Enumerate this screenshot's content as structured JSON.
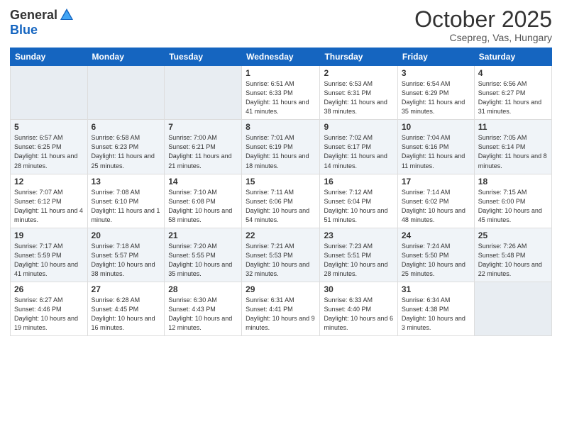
{
  "header": {
    "logo_general": "General",
    "logo_blue": "Blue",
    "month": "October 2025",
    "location": "Csepreg, Vas, Hungary"
  },
  "weekdays": [
    "Sunday",
    "Monday",
    "Tuesday",
    "Wednesday",
    "Thursday",
    "Friday",
    "Saturday"
  ],
  "weeks": [
    [
      {
        "day": "",
        "sunrise": "",
        "sunset": "",
        "daylight": ""
      },
      {
        "day": "",
        "sunrise": "",
        "sunset": "",
        "daylight": ""
      },
      {
        "day": "",
        "sunrise": "",
        "sunset": "",
        "daylight": ""
      },
      {
        "day": "1",
        "sunrise": "Sunrise: 6:51 AM",
        "sunset": "Sunset: 6:33 PM",
        "daylight": "Daylight: 11 hours and 41 minutes."
      },
      {
        "day": "2",
        "sunrise": "Sunrise: 6:53 AM",
        "sunset": "Sunset: 6:31 PM",
        "daylight": "Daylight: 11 hours and 38 minutes."
      },
      {
        "day": "3",
        "sunrise": "Sunrise: 6:54 AM",
        "sunset": "Sunset: 6:29 PM",
        "daylight": "Daylight: 11 hours and 35 minutes."
      },
      {
        "day": "4",
        "sunrise": "Sunrise: 6:56 AM",
        "sunset": "Sunset: 6:27 PM",
        "daylight": "Daylight: 11 hours and 31 minutes."
      }
    ],
    [
      {
        "day": "5",
        "sunrise": "Sunrise: 6:57 AM",
        "sunset": "Sunset: 6:25 PM",
        "daylight": "Daylight: 11 hours and 28 minutes."
      },
      {
        "day": "6",
        "sunrise": "Sunrise: 6:58 AM",
        "sunset": "Sunset: 6:23 PM",
        "daylight": "Daylight: 11 hours and 25 minutes."
      },
      {
        "day": "7",
        "sunrise": "Sunrise: 7:00 AM",
        "sunset": "Sunset: 6:21 PM",
        "daylight": "Daylight: 11 hours and 21 minutes."
      },
      {
        "day": "8",
        "sunrise": "Sunrise: 7:01 AM",
        "sunset": "Sunset: 6:19 PM",
        "daylight": "Daylight: 11 hours and 18 minutes."
      },
      {
        "day": "9",
        "sunrise": "Sunrise: 7:02 AM",
        "sunset": "Sunset: 6:17 PM",
        "daylight": "Daylight: 11 hours and 14 minutes."
      },
      {
        "day": "10",
        "sunrise": "Sunrise: 7:04 AM",
        "sunset": "Sunset: 6:16 PM",
        "daylight": "Daylight: 11 hours and 11 minutes."
      },
      {
        "day": "11",
        "sunrise": "Sunrise: 7:05 AM",
        "sunset": "Sunset: 6:14 PM",
        "daylight": "Daylight: 11 hours and 8 minutes."
      }
    ],
    [
      {
        "day": "12",
        "sunrise": "Sunrise: 7:07 AM",
        "sunset": "Sunset: 6:12 PM",
        "daylight": "Daylight: 11 hours and 4 minutes."
      },
      {
        "day": "13",
        "sunrise": "Sunrise: 7:08 AM",
        "sunset": "Sunset: 6:10 PM",
        "daylight": "Daylight: 11 hours and 1 minute."
      },
      {
        "day": "14",
        "sunrise": "Sunrise: 7:10 AM",
        "sunset": "Sunset: 6:08 PM",
        "daylight": "Daylight: 10 hours and 58 minutes."
      },
      {
        "day": "15",
        "sunrise": "Sunrise: 7:11 AM",
        "sunset": "Sunset: 6:06 PM",
        "daylight": "Daylight: 10 hours and 54 minutes."
      },
      {
        "day": "16",
        "sunrise": "Sunrise: 7:12 AM",
        "sunset": "Sunset: 6:04 PM",
        "daylight": "Daylight: 10 hours and 51 minutes."
      },
      {
        "day": "17",
        "sunrise": "Sunrise: 7:14 AM",
        "sunset": "Sunset: 6:02 PM",
        "daylight": "Daylight: 10 hours and 48 minutes."
      },
      {
        "day": "18",
        "sunrise": "Sunrise: 7:15 AM",
        "sunset": "Sunset: 6:00 PM",
        "daylight": "Daylight: 10 hours and 45 minutes."
      }
    ],
    [
      {
        "day": "19",
        "sunrise": "Sunrise: 7:17 AM",
        "sunset": "Sunset: 5:59 PM",
        "daylight": "Daylight: 10 hours and 41 minutes."
      },
      {
        "day": "20",
        "sunrise": "Sunrise: 7:18 AM",
        "sunset": "Sunset: 5:57 PM",
        "daylight": "Daylight: 10 hours and 38 minutes."
      },
      {
        "day": "21",
        "sunrise": "Sunrise: 7:20 AM",
        "sunset": "Sunset: 5:55 PM",
        "daylight": "Daylight: 10 hours and 35 minutes."
      },
      {
        "day": "22",
        "sunrise": "Sunrise: 7:21 AM",
        "sunset": "Sunset: 5:53 PM",
        "daylight": "Daylight: 10 hours and 32 minutes."
      },
      {
        "day": "23",
        "sunrise": "Sunrise: 7:23 AM",
        "sunset": "Sunset: 5:51 PM",
        "daylight": "Daylight: 10 hours and 28 minutes."
      },
      {
        "day": "24",
        "sunrise": "Sunrise: 7:24 AM",
        "sunset": "Sunset: 5:50 PM",
        "daylight": "Daylight: 10 hours and 25 minutes."
      },
      {
        "day": "25",
        "sunrise": "Sunrise: 7:26 AM",
        "sunset": "Sunset: 5:48 PM",
        "daylight": "Daylight: 10 hours and 22 minutes."
      }
    ],
    [
      {
        "day": "26",
        "sunrise": "Sunrise: 6:27 AM",
        "sunset": "Sunset: 4:46 PM",
        "daylight": "Daylight: 10 hours and 19 minutes."
      },
      {
        "day": "27",
        "sunrise": "Sunrise: 6:28 AM",
        "sunset": "Sunset: 4:45 PM",
        "daylight": "Daylight: 10 hours and 16 minutes."
      },
      {
        "day": "28",
        "sunrise": "Sunrise: 6:30 AM",
        "sunset": "Sunset: 4:43 PM",
        "daylight": "Daylight: 10 hours and 12 minutes."
      },
      {
        "day": "29",
        "sunrise": "Sunrise: 6:31 AM",
        "sunset": "Sunset: 4:41 PM",
        "daylight": "Daylight: 10 hours and 9 minutes."
      },
      {
        "day": "30",
        "sunrise": "Sunrise: 6:33 AM",
        "sunset": "Sunset: 4:40 PM",
        "daylight": "Daylight: 10 hours and 6 minutes."
      },
      {
        "day": "31",
        "sunrise": "Sunrise: 6:34 AM",
        "sunset": "Sunset: 4:38 PM",
        "daylight": "Daylight: 10 hours and 3 minutes."
      },
      {
        "day": "",
        "sunrise": "",
        "sunset": "",
        "daylight": ""
      }
    ]
  ]
}
